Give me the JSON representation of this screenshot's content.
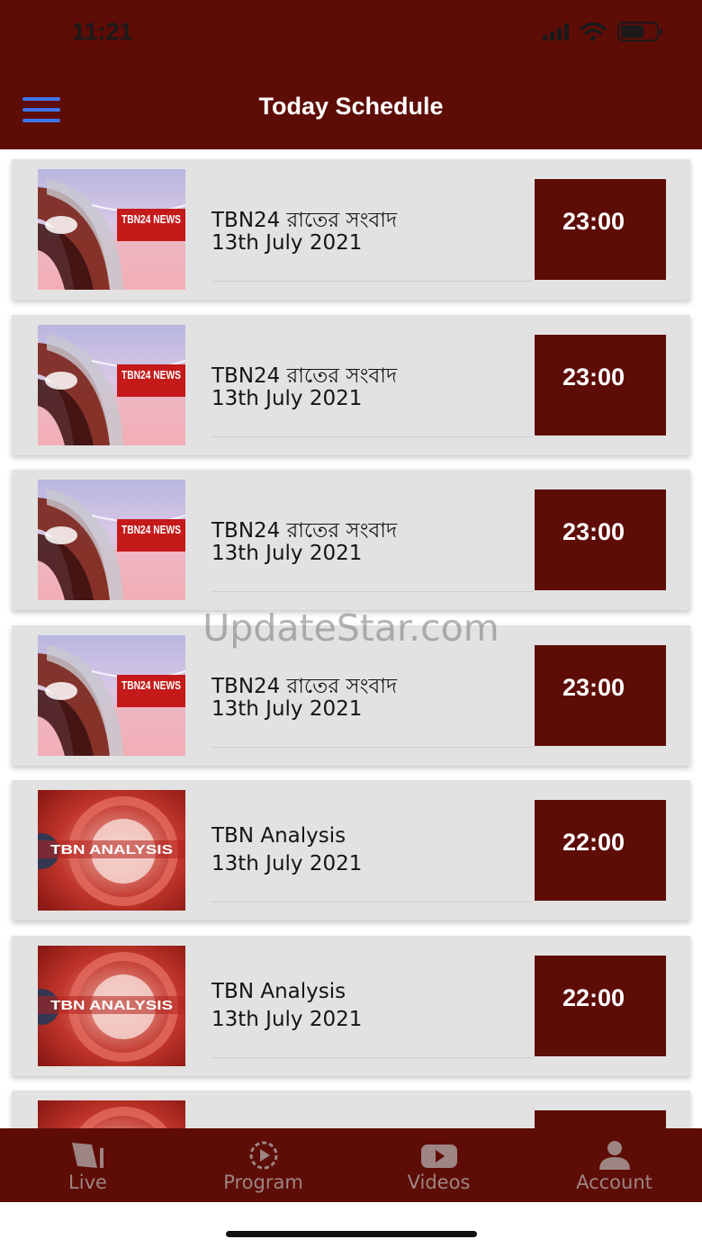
{
  "status_bar": {
    "time": "11:21",
    "battery_level": 0.65
  },
  "header": {
    "title": "Today Schedule"
  },
  "schedule": [
    {
      "thumbnail": "TBN24 NEWS",
      "title": "TBN24 রাতের সংবাদ",
      "date": "13th July 2021",
      "time": "23:00",
      "thumb_style": "news"
    },
    {
      "thumbnail": "TBN24 NEWS",
      "title": "TBN24 রাতের সংবাদ",
      "date": "13th July 2021",
      "time": "23:00",
      "thumb_style": "news"
    },
    {
      "thumbnail": "TBN24 NEWS",
      "title": "TBN24 রাতের সংবাদ",
      "date": "13th July 2021",
      "time": "23:00",
      "thumb_style": "news"
    },
    {
      "thumbnail": "TBN24 NEWS",
      "title": "TBN24 রাতের সংবাদ",
      "date": "13th July 2021",
      "time": "23:00",
      "thumb_style": "news"
    },
    {
      "thumbnail": "TBN ANALYSIS",
      "title": "TBN Analysis",
      "date": "13th July 2021",
      "time": "22:00",
      "thumb_style": "analysis"
    },
    {
      "thumbnail": "TBN ANALYSIS",
      "title": "TBN Analysis",
      "date": "13th July 2021",
      "time": "22:00",
      "thumb_style": "analysis"
    },
    {
      "thumbnail": "",
      "title": "",
      "date": "",
      "time": "",
      "thumb_style": "analysis"
    }
  ],
  "watermark": "UpdateStar.com",
  "bottom_nav": [
    {
      "label": "Live",
      "icon": "live-icon"
    },
    {
      "label": "Program",
      "icon": "play-circle-icon"
    },
    {
      "label": "Videos",
      "icon": "youtube-icon"
    },
    {
      "label": "Account",
      "icon": "account-icon"
    }
  ],
  "colors": {
    "brand": "#5e0c06",
    "row_bg": "#e2e2e2",
    "nav_label": "#9d8583",
    "menu_icon": "#3f74e8"
  }
}
